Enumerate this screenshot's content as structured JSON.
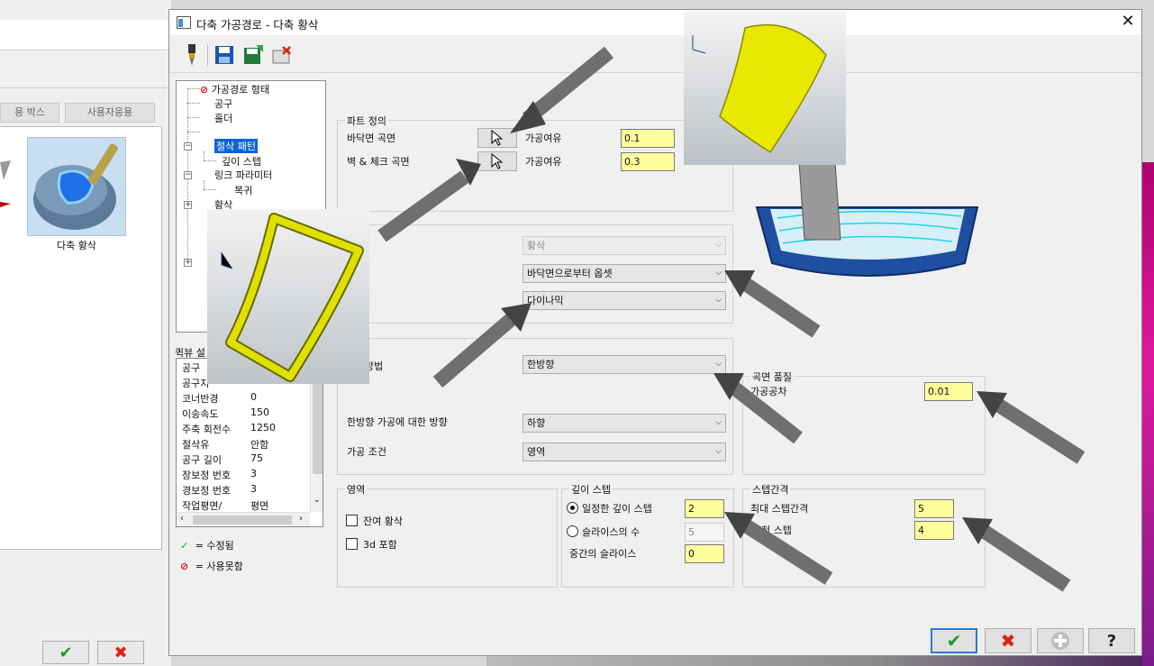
{
  "background_window": {
    "buttons": [
      "용 박스",
      "사용자응용"
    ],
    "tile_label": "다축 황삭"
  },
  "dialog": {
    "title": "다축 가공경로 - 다축 황삭",
    "close_glyph": "✕"
  },
  "tree": {
    "items": [
      "가공경로 형태",
      "공구",
      "홀더",
      "절삭 패턴",
      "깊이 스텝",
      "링크 파라미터",
      "복귀",
      "황삭"
    ]
  },
  "quick_view": {
    "label": "퀵뷰 설",
    "rows": [
      {
        "k": "공구",
        "v": ""
      },
      {
        "k": "공구지",
        "v": ""
      },
      {
        "k": "코너반경",
        "v": "0"
      },
      {
        "k": "이송속도",
        "v": "150"
      },
      {
        "k": "주축 회전수",
        "v": "1250"
      },
      {
        "k": "절삭유",
        "v": "안함"
      },
      {
        "k": "공구 길이",
        "v": "75"
      },
      {
        "k": "장보정 번호",
        "v": "3"
      },
      {
        "k": "경보정 번호",
        "v": "3"
      },
      {
        "k": "작업평면/",
        "v": "평면"
      }
    ]
  },
  "legend": {
    "modified": "= 수정됨",
    "disabled": "= 사용못함"
  },
  "part_definition": {
    "title": "파트 정의",
    "floor_label": "바닥면 곡면",
    "wall_label": "벽 & 체크 곡면",
    "stock_label_1": "가공여유",
    "stock_value_1": "0.1",
    "stock_label_2": "가공여유",
    "stock_value_2": "0.3"
  },
  "pattern": {
    "select_1": "황삭",
    "select_2": "바닥면으로부터 옵셋",
    "select_3": "다이나믹"
  },
  "cutting": {
    "method_label": "방법",
    "method_value": "한방향",
    "direction_label": "한방향 가공에 대한 방향",
    "direction_value": "하향",
    "condition_label": "가공 조건",
    "condition_value": "영역"
  },
  "surface_quality": {
    "title": "곡면 품질",
    "tolerance_label": "가공공차",
    "tolerance_value": "0.01"
  },
  "region": {
    "title": "영역",
    "opt_1": "잔여 황삭",
    "opt_2": "3d 포함"
  },
  "depth_step": {
    "title": "깊이 스텝",
    "opt_1": "일정한 깊이 스텝",
    "opt_1_value": "2",
    "opt_2": "슬라이스의 수",
    "opt_2_value": "5",
    "mid_label": "중간의 슬라이스",
    "mid_value": "0"
  },
  "step_over": {
    "title": "스텝간격",
    "max_label": "최대 스텝간격",
    "max_value": "5",
    "min_label": "전 스텝",
    "min_value": "4"
  },
  "colors": {
    "accent": "#0a64d6",
    "input_yellow": "#ffff9e",
    "ok_green": "#1e9e1e",
    "cancel_red": "#e02010",
    "part_yellow": "#e8e800"
  }
}
